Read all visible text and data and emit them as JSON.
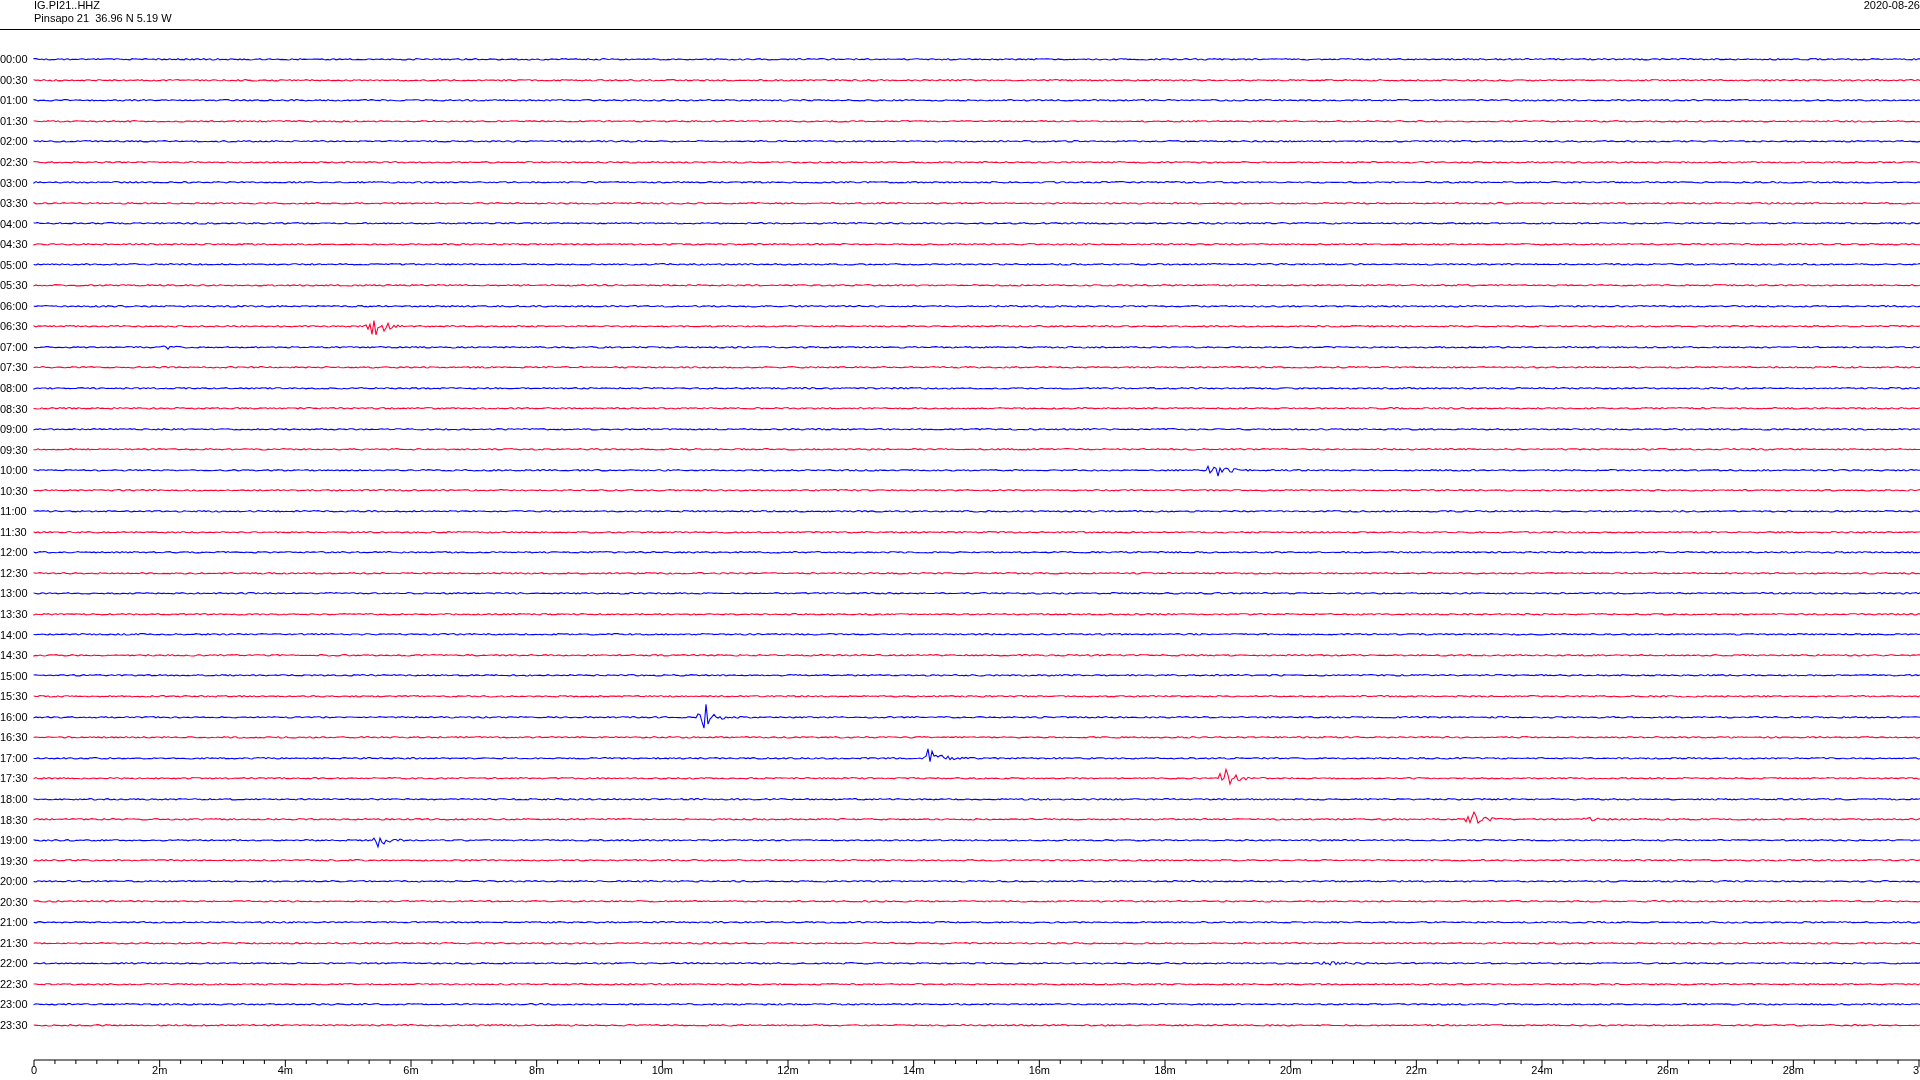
{
  "header": {
    "channel": "IG.PI21..HHZ",
    "station": "Pinsapo 21  36.96 N 5.19 W",
    "date": "2020-08-26"
  },
  "rows": [
    {
      "label": "00:00",
      "color": "#0000ff"
    },
    {
      "label": "00:30",
      "color": "#ff0033"
    },
    {
      "label": "01:00",
      "color": "#0000ff"
    },
    {
      "label": "01:30",
      "color": "#ff0033"
    },
    {
      "label": "02:00",
      "color": "#0000ff"
    },
    {
      "label": "02:30",
      "color": "#ff0033"
    },
    {
      "label": "03:00",
      "color": "#0000ff"
    },
    {
      "label": "03:30",
      "color": "#ff0033"
    },
    {
      "label": "04:00",
      "color": "#0000ff"
    },
    {
      "label": "04:30",
      "color": "#ff0033"
    },
    {
      "label": "05:00",
      "color": "#0000ff"
    },
    {
      "label": "05:30",
      "color": "#ff0033"
    },
    {
      "label": "06:00",
      "color": "#0000ff"
    },
    {
      "label": "06:30",
      "color": "#ff0033"
    },
    {
      "label": "07:00",
      "color": "#0000ff"
    },
    {
      "label": "07:30",
      "color": "#ff0033"
    },
    {
      "label": "08:00",
      "color": "#0000ff"
    },
    {
      "label": "08:30",
      "color": "#ff0033"
    },
    {
      "label": "09:00",
      "color": "#0000ff"
    },
    {
      "label": "09:30",
      "color": "#ff0033"
    },
    {
      "label": "10:00",
      "color": "#0000ff"
    },
    {
      "label": "10:30",
      "color": "#ff0033"
    },
    {
      "label": "11:00",
      "color": "#0000ff"
    },
    {
      "label": "11:30",
      "color": "#ff0033"
    },
    {
      "label": "12:00",
      "color": "#0000ff"
    },
    {
      "label": "12:30",
      "color": "#ff0033"
    },
    {
      "label": "13:00",
      "color": "#0000ff"
    },
    {
      "label": "13:30",
      "color": "#ff0033"
    },
    {
      "label": "14:00",
      "color": "#0000ff"
    },
    {
      "label": "14:30",
      "color": "#ff0033"
    },
    {
      "label": "15:00",
      "color": "#0000ff"
    },
    {
      "label": "15:30",
      "color": "#ff0033"
    },
    {
      "label": "16:00",
      "color": "#0000ff"
    },
    {
      "label": "16:30",
      "color": "#ff0033"
    },
    {
      "label": "17:00",
      "color": "#0000ff"
    },
    {
      "label": "17:30",
      "color": "#ff0033"
    },
    {
      "label": "18:00",
      "color": "#0000ff"
    },
    {
      "label": "18:30",
      "color": "#ff0033"
    },
    {
      "label": "19:00",
      "color": "#0000ff"
    },
    {
      "label": "19:30",
      "color": "#ff0033"
    },
    {
      "label": "20:00",
      "color": "#0000ff"
    },
    {
      "label": "20:30",
      "color": "#ff0033"
    },
    {
      "label": "21:00",
      "color": "#0000ff"
    },
    {
      "label": "21:30",
      "color": "#ff0033"
    },
    {
      "label": "22:00",
      "color": "#0000ff"
    },
    {
      "label": "22:30",
      "color": "#ff0033"
    },
    {
      "label": "23:00",
      "color": "#0000ff"
    },
    {
      "label": "23:30",
      "color": "#ff0033"
    }
  ],
  "x_axis": {
    "tick_labels": [
      "0",
      "2m",
      "4m",
      "6m",
      "8m",
      "10m",
      "12m",
      "14m",
      "16m",
      "18m",
      "20m",
      "22m",
      "24m",
      "26m",
      "28m",
      "3"
    ]
  }
}
